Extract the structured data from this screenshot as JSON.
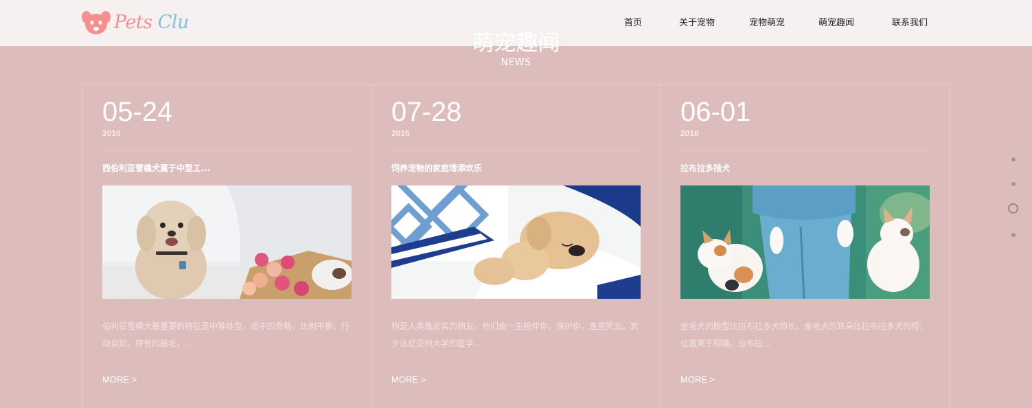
{
  "brand": {
    "name_part1": "Pets",
    "name_part2": "Clu"
  },
  "nav": [
    {
      "label": "首页"
    },
    {
      "label": "关于宠物"
    },
    {
      "label": "宠物萌宠"
    },
    {
      "label": "萌宠趣闻"
    },
    {
      "label": "联系我们"
    }
  ],
  "section": {
    "title": "萌宠趣闻",
    "subtitle": "NEWS"
  },
  "cards": [
    {
      "date": "05-24",
      "year": "2016",
      "title": "西伯利亚雪橇犬属于中型工...",
      "image": "curly-dog-with-roses",
      "desc": "伯利亚雪橇犬最重要的特征是中等体型，适中的骨骼，比例平衡，行动自如，特有的被毛，...",
      "more": "MORE >"
    },
    {
      "date": "07-28",
      "year": "2016",
      "title": "饲养宠物的家庭增添欢乐",
      "image": "puppy-sleeping-on-bed",
      "desc": "狗是人类最忠实的朋友，他们会一生陪伴你，保护你，直至死去。宾夕法尼亚州大学的医学...",
      "more": "MORE >"
    },
    {
      "date": "06-01",
      "year": "2016",
      "title": "拉布拉多猎犬",
      "image": "kittens-climbing-jeans",
      "desc": "金毛犬的脸型比拉布拉多犬的长。金毛犬的耳朵比拉布拉多犬的短，位置高于眼睛。拉布拉...",
      "more": "MORE >"
    }
  ],
  "side_nav": {
    "count": 4,
    "active_index": 2
  },
  "colors": {
    "background": "#ddbdbc",
    "header": "#f6f0f1",
    "logo_pink": "#f4908e",
    "logo_blue": "#7cc4d6"
  }
}
